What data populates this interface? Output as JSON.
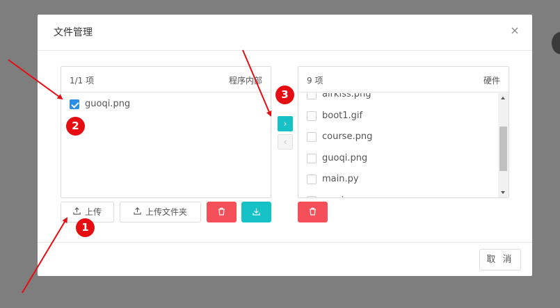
{
  "dialog": {
    "title": "文件管理",
    "close_glyph": "×",
    "cancel_label": "取 消"
  },
  "left_panel": {
    "count": "1/1 项",
    "name": "程序内部",
    "items": [
      {
        "label": "guoqi.png",
        "checked": true
      }
    ]
  },
  "right_panel": {
    "count": "9 项",
    "name": "硬件",
    "items": [
      {
        "label": "airkiss.png",
        "checked": false
      },
      {
        "label": "boot1.gif",
        "checked": false
      },
      {
        "label": "course.png",
        "checked": false
      },
      {
        "label": "guoqi.png",
        "checked": false
      },
      {
        "label": "main.py",
        "checked": false
      },
      {
        "label": "music",
        "checked": false
      }
    ]
  },
  "transfer": {
    "to_right_glyph": "›",
    "to_left_glyph": "‹"
  },
  "buttons": {
    "upload_label": "上传",
    "upload_folder_label": "上传文件夹",
    "upload_icon": "upload-icon",
    "delete_icon": "trash-icon",
    "download_icon": "download-icon"
  },
  "annotations": {
    "badges": [
      "1",
      "2",
      "3"
    ],
    "color": "#e50d12"
  },
  "colors": {
    "accent": "#2e8ee6",
    "teal": "#17c2c6",
    "danger": "#f5505a"
  }
}
